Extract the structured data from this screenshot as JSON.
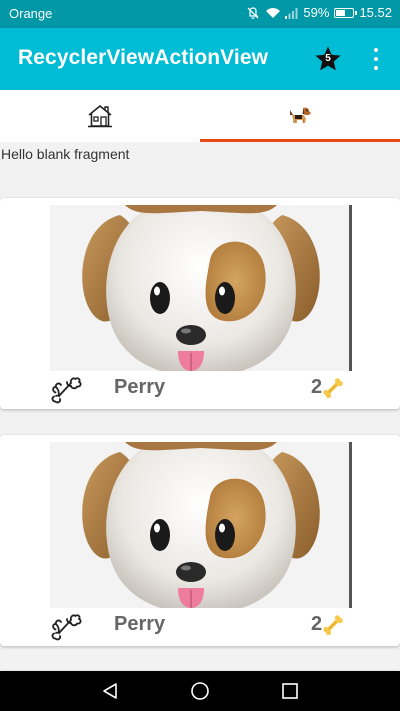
{
  "status_bar": {
    "carrier": "Orange",
    "battery_percent": "59%",
    "battery_level": 0.59,
    "time": "15.52",
    "icons": [
      "mute-icon",
      "wifi-icon",
      "signal-icon",
      "battery-icon"
    ]
  },
  "toolbar": {
    "title": "RecyclerViewActionView",
    "star_count": "5",
    "star_icon": "star-icon",
    "overflow_icon": "overflow-menu-icon"
  },
  "tabs": [
    {
      "icon": "house-icon",
      "selected": false
    },
    {
      "icon": "dog-icon",
      "selected": true
    }
  ],
  "colors": {
    "status_bar": "#0097a7",
    "toolbar": "#00bcd4",
    "tab_indicator": "#e64a19",
    "background": "#f2f2f2"
  },
  "content": {
    "text": "Hello blank fragment",
    "cards": [
      {
        "image": "dog-face-image",
        "action_icon": "bone-outline-icon",
        "name": "Perry",
        "count": "2",
        "count_icon": "bone-icon"
      },
      {
        "image": "dog-face-image",
        "action_icon": "bone-outline-icon",
        "name": "Perry",
        "count": "2",
        "count_icon": "bone-icon"
      }
    ]
  },
  "nav_bar": {
    "buttons": [
      "back-icon",
      "home-icon",
      "recents-icon"
    ]
  }
}
